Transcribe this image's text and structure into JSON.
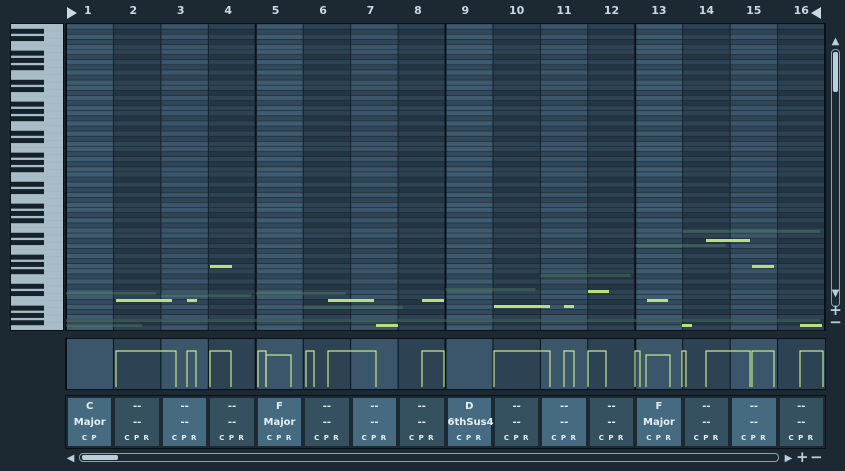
{
  "ruler": {
    "bars": [
      "1",
      "2",
      "3",
      "4",
      "5",
      "6",
      "7",
      "8",
      "9",
      "10",
      "11",
      "12",
      "13",
      "14",
      "15",
      "16"
    ]
  },
  "chords": [
    {
      "root": "C",
      "type": "Major",
      "cpr": "C P"
    },
    {
      "root": "--",
      "type": "--",
      "cpr": "C P R"
    },
    {
      "root": "--",
      "type": "--",
      "cpr": "C P R"
    },
    {
      "root": "--",
      "type": "--",
      "cpr": "C P R"
    },
    {
      "root": "F",
      "type": "Major",
      "cpr": "C P R"
    },
    {
      "root": "--",
      "type": "--",
      "cpr": "C P R"
    },
    {
      "root": "--",
      "type": "--",
      "cpr": "C P R"
    },
    {
      "root": "--",
      "type": "--",
      "cpr": "C P R"
    },
    {
      "root": "D",
      "type": "6thSus4",
      "cpr": "C P R"
    },
    {
      "root": "--",
      "type": "--",
      "cpr": "C P R"
    },
    {
      "root": "--",
      "type": "--",
      "cpr": "C P R"
    },
    {
      "root": "--",
      "type": "--",
      "cpr": "C P R"
    },
    {
      "root": "F",
      "type": "Major",
      "cpr": "C P R"
    },
    {
      "root": "--",
      "type": "--",
      "cpr": "C P R"
    },
    {
      "root": "--",
      "type": "--",
      "cpr": "C P R"
    },
    {
      "root": "--",
      "type": "--",
      "cpr": "C P R"
    }
  ],
  "icons": {
    "play_left": "play-triangle-icon",
    "loop_end": "loop-end-triangle-icon",
    "scroll_up": "scroll-up-arrow-icon",
    "scroll_down": "scroll-down-arrow-icon",
    "zoom_in": "zoom-in-plus-icon",
    "zoom_out": "zoom-out-minus-icon",
    "scroll_left": "scroll-left-arrow-icon",
    "scroll_right": "scroll-right-arrow-icon"
  },
  "colors": {
    "note": "#b8e07a",
    "envelope": "#c8e68c",
    "bar_light": "#3d5a6e",
    "bar_dark": "#2a3d4b",
    "chord_cell": "#3f6176"
  },
  "symbols": {
    "scroll_up": "▲",
    "scroll_down": "▼",
    "plus": "+",
    "minus": "−",
    "scroll_left": "◀",
    "scroll_right": "▶"
  }
}
